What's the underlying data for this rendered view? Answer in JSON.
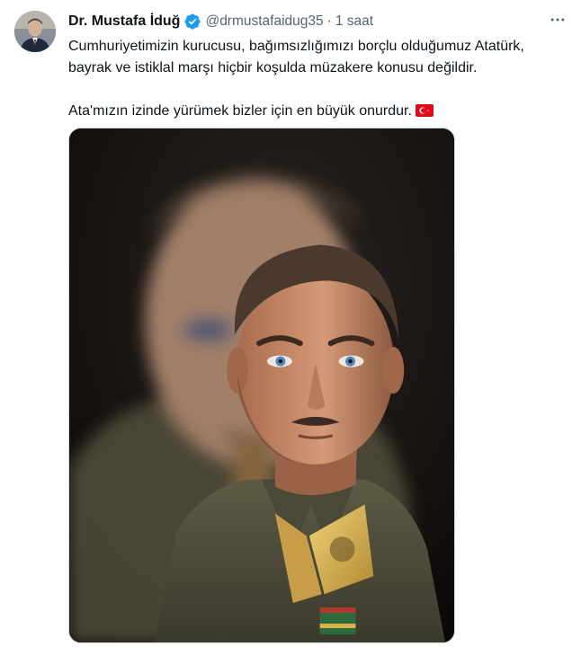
{
  "tweet": {
    "author": {
      "display_name": "Dr. Mustafa İduğ",
      "handle": "@drmustafaidug35",
      "verified_icon": "verified-badge-icon",
      "accent_color": "#1d9bf0"
    },
    "separator": "·",
    "time": "1 saat",
    "more_icon": "more-options-icon",
    "more_label": "· ·",
    "text_line1": "Cumhuriyetimizin kurucusu, bağımsızlığımızı borçlu olduğumuz Atatürk, bayrak ve istiklal marşı hiçbir koşulda müzakere konusu değildir.",
    "text_line2": "Ata'mızın izinde yürümek bizler için en büyük onurdur.",
    "flag_icon": "turkey-flag-icon",
    "media_icon": "portrait-photo-icon"
  }
}
